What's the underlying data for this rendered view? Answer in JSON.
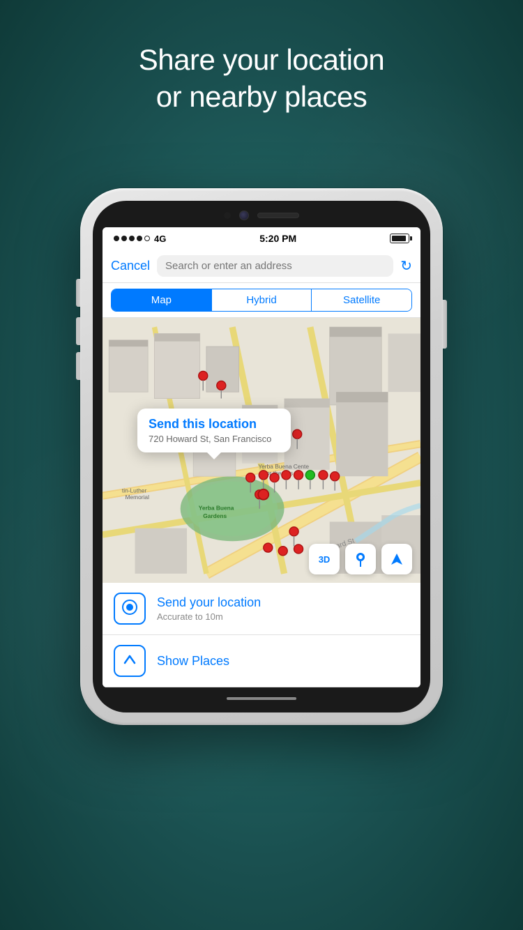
{
  "background": {
    "color": "#1a5c5a"
  },
  "header": {
    "title": "Share your location\nor nearby places"
  },
  "status_bar": {
    "signal": "●●●●○",
    "network": "4G",
    "time": "5:20 PM",
    "battery_level": 90
  },
  "search": {
    "cancel_label": "Cancel",
    "placeholder": "Search or enter an address"
  },
  "map_tabs": {
    "items": [
      {
        "label": "Map",
        "active": true
      },
      {
        "label": "Hybrid",
        "active": false
      },
      {
        "label": "Satellite",
        "active": false
      }
    ]
  },
  "map": {
    "popup": {
      "title": "Send this location",
      "address": "720 Howard St, San Francisco"
    },
    "label_yerba": "Yerba Buena\nGardens",
    "label_martin": "tin-Luther\nMemorial",
    "label_arts": "Yerba Buena Cente\nfor the Arts",
    "label_howard": "Howard St"
  },
  "map_controls": {
    "btn_3d": "3D",
    "btn_pin_icon": "📍",
    "btn_location_icon": "➤"
  },
  "list": {
    "items": [
      {
        "id": "send-location",
        "icon": "◉",
        "title": "Send your location",
        "subtitle": "Accurate to 10m"
      },
      {
        "id": "show-places",
        "icon": "⬆",
        "title": "Show Places",
        "subtitle": ""
      }
    ]
  }
}
